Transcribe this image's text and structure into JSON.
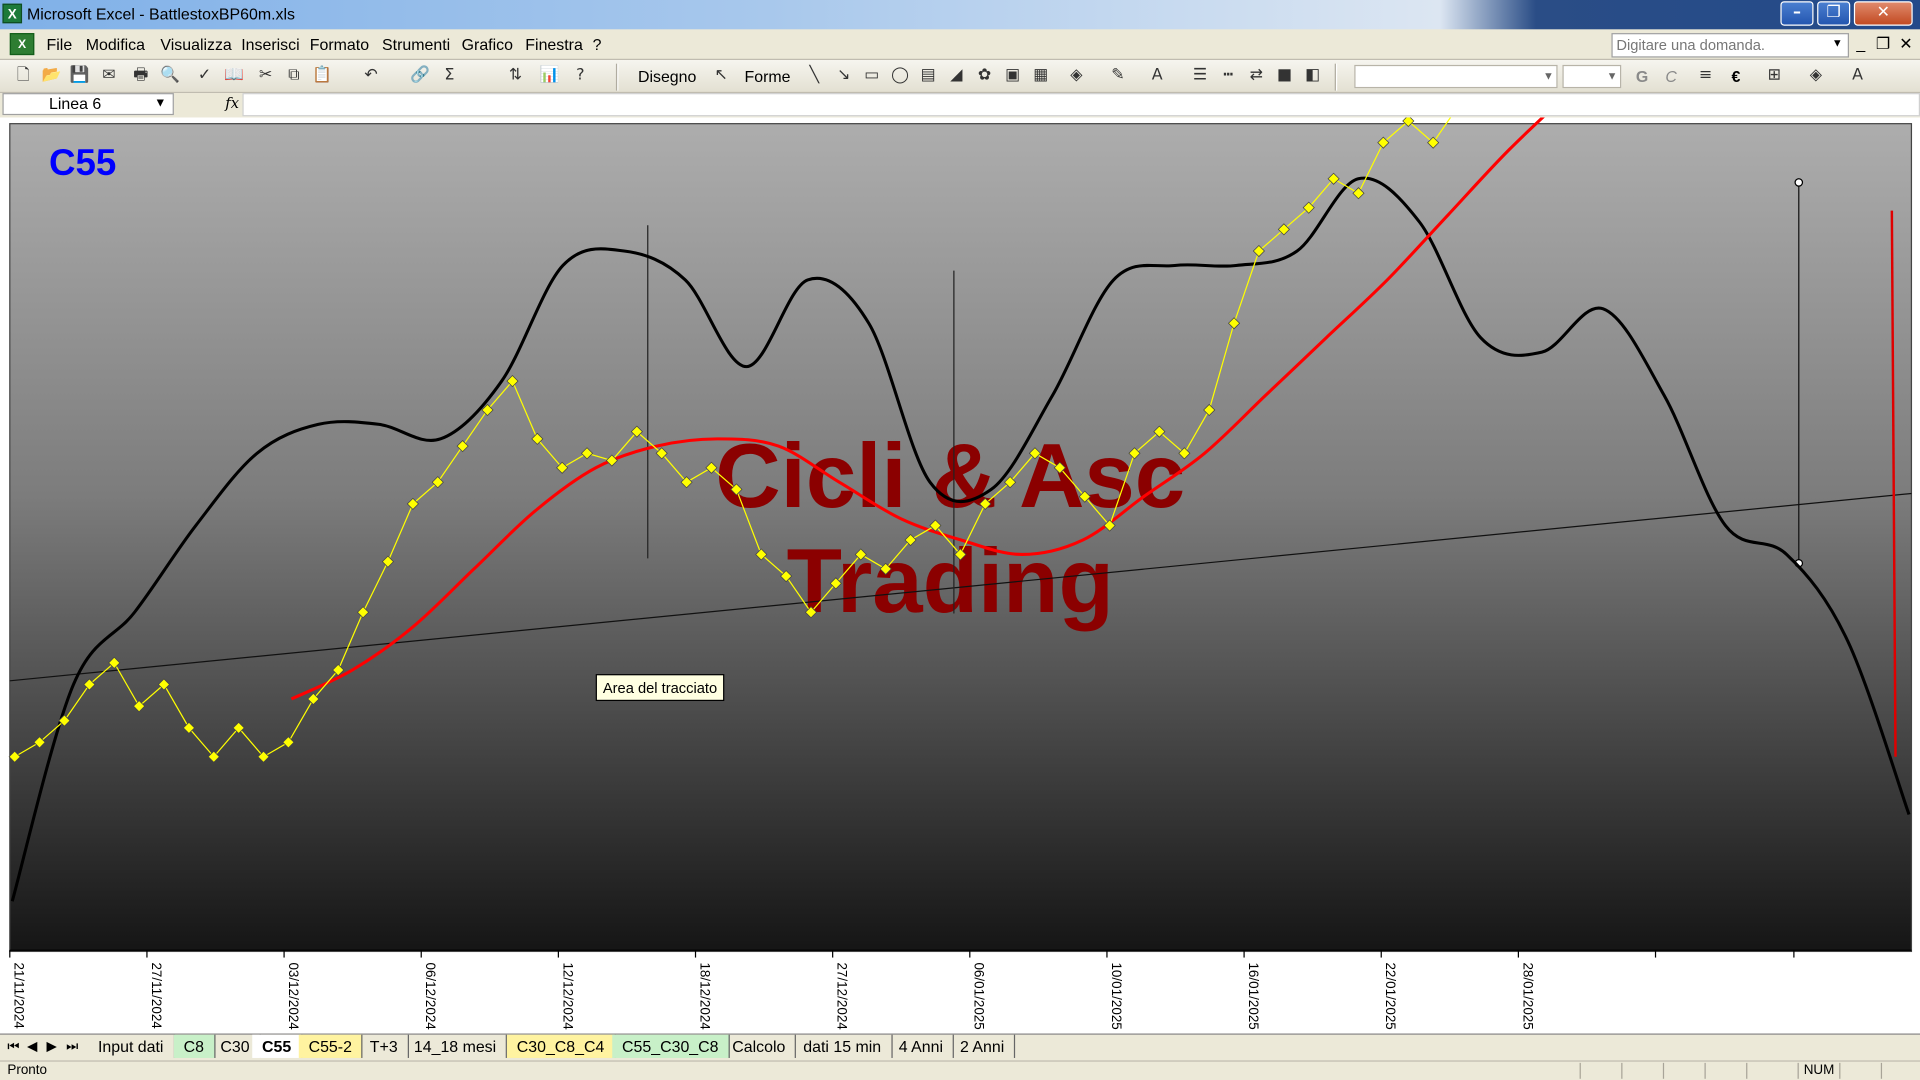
{
  "window": {
    "title": "Microsoft Excel - BattlestoxBP60m.xls",
    "app_icon": "excel-icon",
    "controls": [
      "minimize-icon",
      "restore-icon",
      "close-icon"
    ]
  },
  "menu": {
    "items": [
      "File",
      "Modifica",
      "Visualizza",
      "Inserisci",
      "Formato",
      "Strumenti",
      "Grafico",
      "Finestra",
      "?"
    ],
    "ask_placeholder": "Digitare una domanda."
  },
  "toolbar": {
    "draw_label": "Disegno",
    "shapes_label": "Forme",
    "bold_label": "G",
    "italic_label": "C",
    "euro_label": "€"
  },
  "formula_bar": {
    "name_box": "Linea 6",
    "fx": "fx",
    "value": ""
  },
  "chart": {
    "title_badge": "C55",
    "watermark_line1": "Cicli & Asc",
    "watermark_line2": "Trading",
    "tooltip": "Area del tracciato",
    "colors": {
      "background_top": "#a9a9a9",
      "background_bottom": "#1a1a1a",
      "price": "#ffff00",
      "moving_average": "#ff0000",
      "cycle": "#000000",
      "badge": "#0000ff",
      "watermark": "#8b0000"
    }
  },
  "chart_data": {
    "type": "line",
    "x_tick_labels": [
      "21/11/2024",
      "27/11/2024",
      "03/12/2024",
      "06/12/2024",
      "12/12/2024",
      "18/12/2024",
      "27/12/2024",
      "06/01/2025",
      "10/01/2025",
      "16/01/2025",
      "22/01/2025",
      "28/01/2025"
    ],
    "series": [
      {
        "legend": "price",
        "style": "yellow diamond markers",
        "relative_level": [
          0.2,
          0.22,
          0.25,
          0.3,
          0.33,
          0.27,
          0.3,
          0.24,
          0.2,
          0.24,
          0.2,
          0.22,
          0.28,
          0.32,
          0.4,
          0.47,
          0.55,
          0.58,
          0.63,
          0.68,
          0.72,
          0.64,
          0.6,
          0.62,
          0.61,
          0.65,
          0.62,
          0.58,
          0.6,
          0.57,
          0.48,
          0.45,
          0.4,
          0.44,
          0.48,
          0.46,
          0.5,
          0.52,
          0.48,
          0.55,
          0.58,
          0.62,
          0.6,
          0.56,
          0.52,
          0.62,
          0.65,
          0.62,
          0.68,
          0.8,
          0.9,
          0.93,
          0.96,
          1.0,
          0.98,
          1.05,
          1.08,
          1.05,
          1.1,
          1.13,
          1.2,
          1.18,
          1.2
        ]
      },
      {
        "legend": "moving average",
        "style": "red line",
        "relative_level": [
          0.28,
          0.32,
          0.38,
          0.46,
          0.54,
          0.6,
          0.63,
          0.64,
          0.63,
          0.58,
          0.53,
          0.5,
          0.48,
          0.5,
          0.56,
          0.62,
          0.7,
          0.78,
          0.86,
          0.95,
          1.04,
          1.12
        ]
      },
      {
        "legend": "cycle",
        "style": "black smooth line",
        "relative_level": [
          0.0,
          0.3,
          0.4,
          0.52,
          0.62,
          0.66,
          0.66,
          0.64,
          0.72,
          0.88,
          0.9,
          0.86,
          0.74,
          0.86,
          0.8,
          0.58,
          0.57,
          0.7,
          0.86,
          0.88,
          0.88,
          0.9,
          1.0,
          0.94,
          0.78,
          0.76,
          0.82,
          0.7,
          0.52,
          0.48,
          0.36,
          0.12
        ]
      }
    ],
    "trendline": "rising thin black line",
    "grid": false,
    "legend_position": "none"
  },
  "sheet_tabs": [
    {
      "label": "Input dati",
      "style": "normal"
    },
    {
      "label": "C8",
      "style": "green"
    },
    {
      "label": "C30",
      "style": "normal"
    },
    {
      "label": "C55",
      "style": "active"
    },
    {
      "label": "C55-2",
      "style": "yellow"
    },
    {
      "label": "T+3",
      "style": "normal"
    },
    {
      "label": "14_18 mesi",
      "style": "normal"
    },
    {
      "label": "C30_C8_C4",
      "style": "yellow"
    },
    {
      "label": "C55_C30_C8",
      "style": "green"
    },
    {
      "label": "Calcolo",
      "style": "normal"
    },
    {
      "label": "dati 15 min",
      "style": "normal"
    },
    {
      "label": "4 Anni",
      "style": "normal"
    },
    {
      "label": "2 Anni",
      "style": "normal"
    }
  ],
  "status": {
    "text": "Pronto",
    "num": "NUM"
  }
}
